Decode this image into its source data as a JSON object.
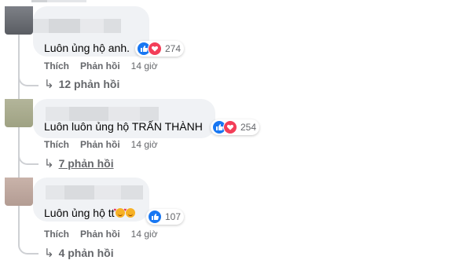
{
  "comments": [
    {
      "text": "Luôn ủng hộ anh.",
      "reaction_count": "274",
      "reactions": [
        "like-icon",
        "love-icon"
      ],
      "actions": {
        "like": "Thích",
        "reply": "Phản hồi",
        "time": "14 giờ"
      },
      "replies_label": "12 phản hồi"
    },
    {
      "text": "Luôn luôn ủng hộ TRẤN THÀNH",
      "reaction_count": "254",
      "reactions": [
        "like-icon",
        "love-icon"
      ],
      "actions": {
        "like": "Thích",
        "reply": "Phản hồi",
        "time": "14 giờ"
      },
      "replies_label": "7 phản hồi"
    },
    {
      "text": "Luôn ủng hộ tt",
      "emojis": [
        "smiling-face-with-hearts-emoji",
        "smiling-face-with-hearts-emoji"
      ],
      "reaction_count": "107",
      "reactions": [
        "like-icon"
      ],
      "actions": {
        "like": "Thích",
        "reply": "Phản hồi",
        "time": "14 giờ"
      },
      "replies_label": "4 phản hồi"
    }
  ],
  "colors": {
    "bubble": "#f0f2f5",
    "secondary_text": "#65676b",
    "like_blue": "#1877f2",
    "love_red": "#f33e58"
  }
}
